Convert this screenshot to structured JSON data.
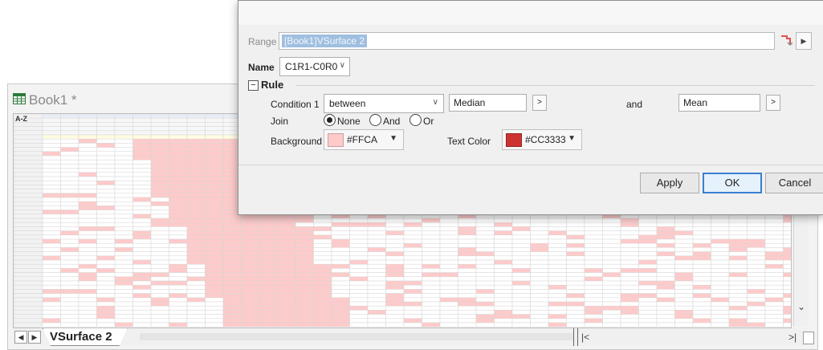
{
  "workbook": {
    "title": "Book1 *",
    "corner_label": "A-Z",
    "sheet_tab": "VSurface 2",
    "nav_prev": "◀",
    "nav_next": "▶",
    "vscroll_down": "⌄",
    "hscroll_left": "|<",
    "hscroll_right": ">|"
  },
  "dialog": {
    "range_label": "Range",
    "range_value": "[Book1]VSurface 2",
    "range_more": "▶",
    "name_label": "Name",
    "name_value": "C1R1-C0R0",
    "rule_toggle": "⊟",
    "rule_label": "Rule",
    "condition_label": "Condition 1",
    "condition_value": "between",
    "operand1": "Median",
    "operand_btn": ">",
    "and_label": "and",
    "operand2": "Mean",
    "join_label": "Join",
    "join_options": [
      "None",
      "And",
      "Or"
    ],
    "join_selected": "None",
    "background_label": "Background",
    "background_value": "#FFCA",
    "text_color_label": "Text Color",
    "text_color_value": "#CC3333",
    "buttons": {
      "apply": "Apply",
      "ok": "OK",
      "cancel": "Cancel"
    }
  },
  "colors": {
    "highlight_bg": "#FFCACA",
    "highlight_text": "#CC3333",
    "header_yellow": "#FFFBE0"
  }
}
